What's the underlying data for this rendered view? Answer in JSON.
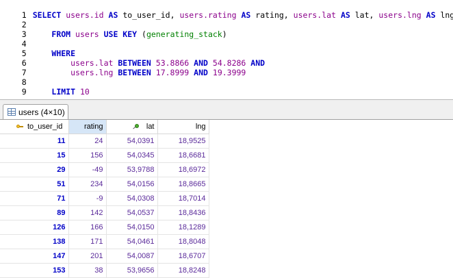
{
  "editor": {
    "line_numbers": [
      "1",
      "2",
      "3",
      "4",
      "5",
      "6",
      "7",
      "8",
      "9"
    ],
    "line1": {
      "select": "SELECT",
      "t1": "users",
      "f1": ".id",
      "as1": "AS",
      "a1": "to_user_id,",
      "t2": "users",
      "f2": ".rating",
      "as2": "AS",
      "a2": "rating,",
      "t3": "users",
      "f3": ".lat",
      "as3": "AS",
      "a3": "lat,",
      "t4": "users",
      "f4": ".lng",
      "as4": "AS",
      "a4": "lng"
    },
    "line3": {
      "from": "FROM",
      "table": "users",
      "use_key": "USE KEY",
      "open": "(",
      "index": "generating_stack",
      "close": ")"
    },
    "line5": {
      "where": "WHERE"
    },
    "line6": {
      "table": "users",
      "field": ".lat",
      "between": "BETWEEN",
      "low": "53.8866",
      "and": "AND",
      "high": "54.8286",
      "and2": "AND"
    },
    "line7": {
      "table": "users",
      "field": ".lng",
      "between": "BETWEEN",
      "low": "17.8999",
      "and": "AND",
      "high": "19.3999"
    },
    "line9": {
      "limit": "LIMIT",
      "value": "10"
    }
  },
  "result_tab": {
    "label": "users (4×10)",
    "icon": "grid-icon"
  },
  "grid": {
    "columns": [
      {
        "label": "to_user_id",
        "icon": "key-icon"
      },
      {
        "label": "rating"
      },
      {
        "label": "lat",
        "icon": "pin-icon"
      },
      {
        "label": "lng"
      }
    ],
    "rows": [
      [
        "11",
        "24",
        "54,0391",
        "18,9525"
      ],
      [
        "15",
        "156",
        "54,0345",
        "18,6681"
      ],
      [
        "29",
        "-49",
        "53,9788",
        "18,6972"
      ],
      [
        "51",
        "234",
        "54,0156",
        "18,8665"
      ],
      [
        "71",
        "-9",
        "54,0308",
        "18,7014"
      ],
      [
        "89",
        "142",
        "54,0537",
        "18,8436"
      ],
      [
        "126",
        "166",
        "54,0150",
        "18,1289"
      ],
      [
        "138",
        "171",
        "54,0461",
        "18,8048"
      ],
      [
        "147",
        "201",
        "54,0087",
        "18,6707"
      ],
      [
        "153",
        "38",
        "53,9656",
        "18,8248"
      ]
    ]
  },
  "colors": {
    "keyword": "#0000c8",
    "identifier": "#8b008b",
    "index_name": "#008000",
    "cell_value": "#5a2a9a",
    "sorted_header": "#d6e6f7"
  }
}
